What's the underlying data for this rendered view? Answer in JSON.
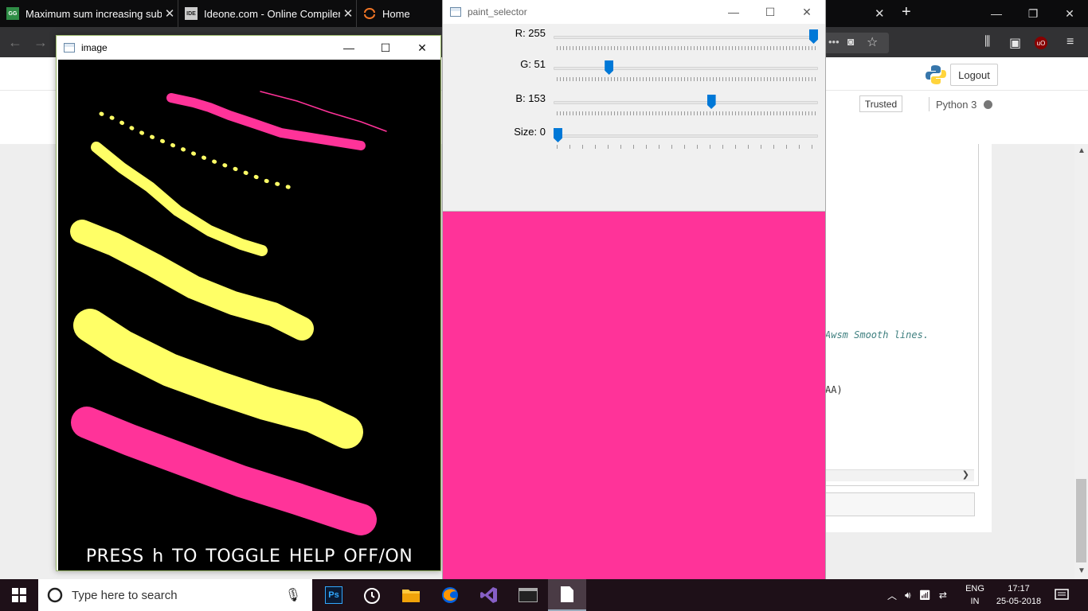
{
  "browser": {
    "tabs": [
      {
        "title": "Maximum sum increasing subs",
        "favicon": "gfg-favicon"
      },
      {
        "title": "Ideone.com - Online Compiler",
        "favicon": "ideone-favicon"
      },
      {
        "title": "Home",
        "favicon": "jupyter-favicon"
      }
    ],
    "toolbar_icons": [
      "library-icon",
      "sidebar-icon",
      "ublock-icon",
      "menu-icon",
      "pocket-icon",
      "bookmark-star-icon"
    ]
  },
  "jupyter": {
    "logout_label": "Logout",
    "trusted_label": "Trusted",
    "kernel_label": "Python 3",
    "visible_comment": "Awsm Smooth lines.",
    "visible_code": "AA)"
  },
  "image_window": {
    "title": "image",
    "help_text": "PRESS h TO TOGGLE  HELP OFF/ON",
    "stroke_colors": {
      "pink": "#ff3399",
      "yellow": "#ffff66"
    }
  },
  "paint_selector": {
    "title": "paint_selector",
    "trackbars": [
      {
        "label": "R: 255",
        "value": 255,
        "max": 255
      },
      {
        "label": "G: 51",
        "value": 51,
        "max": 255
      },
      {
        "label": "B: 153",
        "value": 153,
        "max": 255
      },
      {
        "label": "Size: 0",
        "value": 0,
        "max": 20
      }
    ],
    "preview_color": "#ff3399"
  },
  "taskbar": {
    "search_placeholder": "Type here to search",
    "apps": [
      "photoshop-icon",
      "alarms-clock-icon",
      "file-explorer-icon",
      "firefox-icon",
      "visual-studio-icon",
      "terminal-icon",
      "notepad-icon"
    ],
    "lang_top": "ENG",
    "lang_bottom": "IN",
    "time": "17:17",
    "date": "25-05-2018"
  }
}
